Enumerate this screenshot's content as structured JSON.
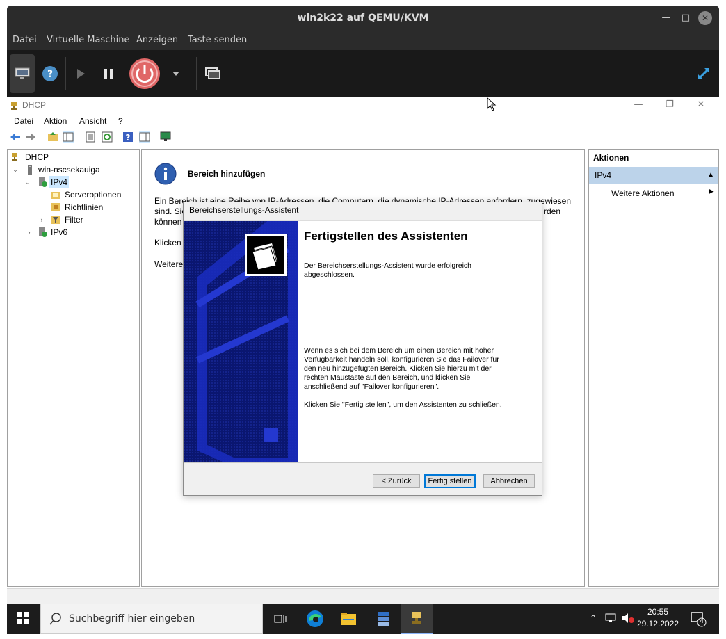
{
  "host": {
    "title": "win2k22 auf QEMU/KVM",
    "menu": [
      "Datei",
      "Virtuelle Maschine",
      "Anzeigen",
      "Taste senden"
    ],
    "toolbar_icons": [
      "monitor-icon",
      "help-icon",
      "play-icon",
      "pause-icon",
      "power-icon",
      "dropdown-icon",
      "screens-icon",
      "fullscreen-icon"
    ]
  },
  "mmc": {
    "title": "DHCP",
    "menu": [
      "Datei",
      "Aktion",
      "Ansicht",
      "?"
    ],
    "tree": {
      "root": "DHCP",
      "server": "win-nscsekauiga",
      "ipv4": "IPv4",
      "children": [
        "Serveroptionen",
        "Richtlinien",
        "Filter"
      ],
      "ipv6": "IPv6"
    },
    "content": {
      "title": "Bereich hinzufügen",
      "line1": "Ein Bereich ist eine Reihe von IP-Adressen, die Computern, die dynamische IP-Adressen anfordern, zugewiesen",
      "line2": "sind. Sie",
      "line2_end": "rden",
      "line3": "können",
      "line4": "Klicken",
      "line5": "Weitere"
    },
    "actions": {
      "header": "Aktionen",
      "section": "IPv4",
      "item": "Weitere Aktionen"
    }
  },
  "wizard": {
    "title": "Bereichserstellungs-Assistent",
    "heading": "Fertigstellen des Assistenten",
    "para1": "Der Bereichserstellungs-Assistent wurde erfolgreich abgeschlossen.",
    "para2": "Wenn es sich bei dem Bereich um einen Bereich mit hoher Verfügbarkeit handeln soll, konfigurieren Sie das Failover für den neu hinzugefügten Bereich. Klicken Sie hierzu mit der rechten Maustaste auf den Bereich, und klicken Sie anschließend auf \"Failover konfigurieren\".",
    "para3": "Klicken Sie \"Fertig stellen\", um den Assistenten zu schließen.",
    "buttons": {
      "back": "< Zurück",
      "finish": "Fertig stellen",
      "cancel": "Abbrechen"
    }
  },
  "taskbar": {
    "search_placeholder": "Suchbegriff hier eingeben",
    "time": "20:55",
    "date": "29.12.2022",
    "notifications": "4"
  }
}
